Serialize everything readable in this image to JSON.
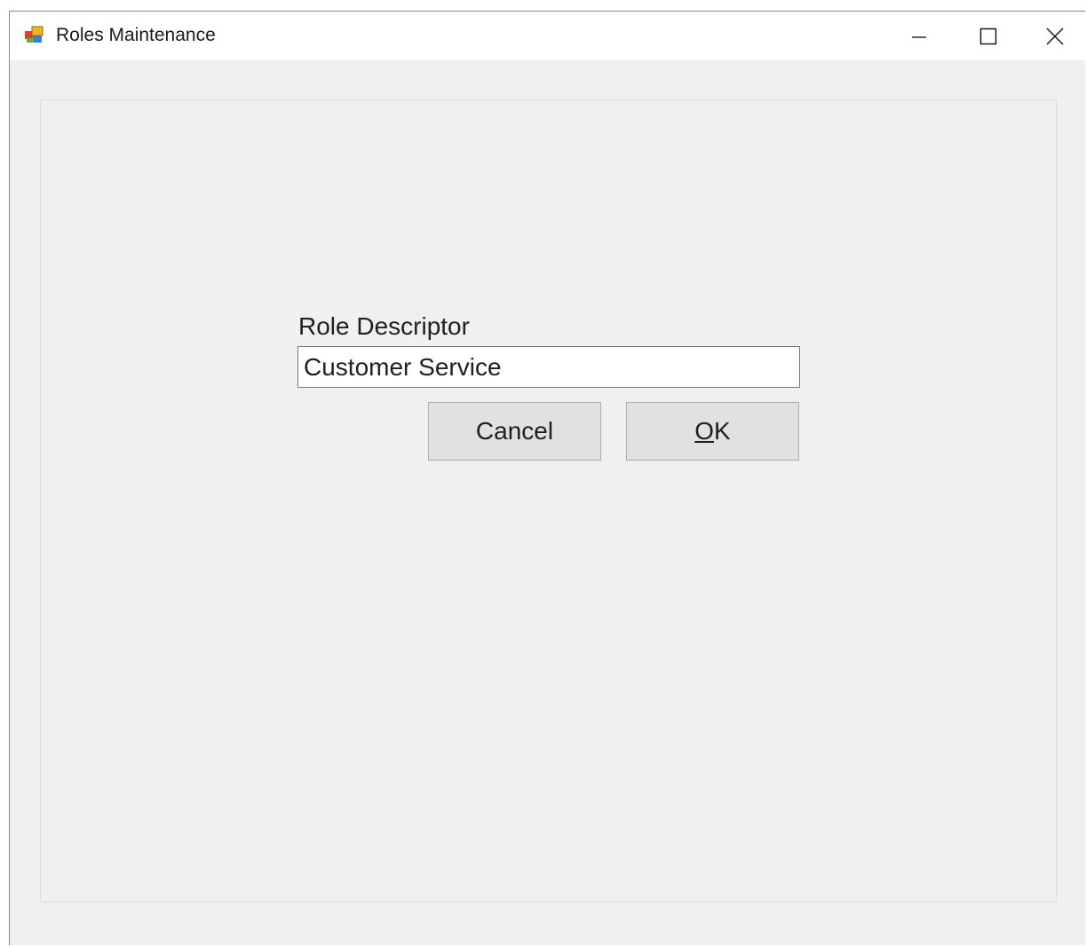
{
  "window": {
    "title": "Roles Maintenance",
    "icon": "form-app-icon",
    "controls": {
      "minimize": "minimize-icon",
      "maximize": "maximize-icon",
      "close": "close-icon"
    }
  },
  "form": {
    "role_descriptor_label": "Role Descriptor",
    "role_descriptor_value": "Customer Service",
    "cancel_label": "Cancel",
    "ok_accelerator": "O",
    "ok_rest": "K"
  },
  "colors": {
    "window_background": "#f0f0f0",
    "titlebar_background": "#ffffff",
    "button_face": "#e1e1e1",
    "button_border": "#adadad",
    "input_border": "#7a7a7a"
  }
}
